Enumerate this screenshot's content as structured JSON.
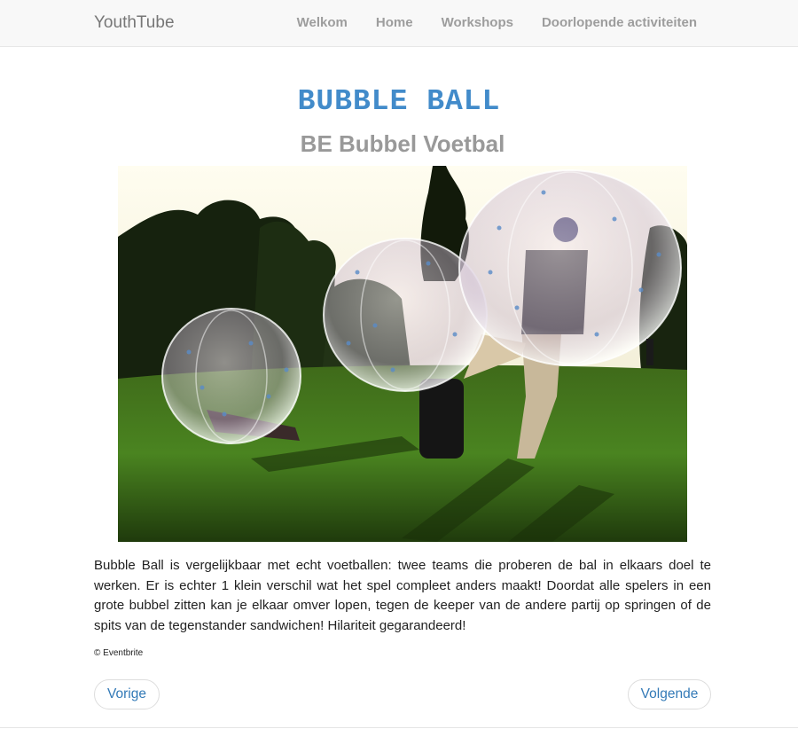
{
  "navbar": {
    "brand": "YouthTube",
    "items": [
      {
        "label": "Welkom"
      },
      {
        "label": "Home"
      },
      {
        "label": "Workshops"
      },
      {
        "label": "Doorlopende activiteiten"
      }
    ]
  },
  "main": {
    "title": "BUBBLE BALL",
    "subtitle": "BE Bubbel Voetbal",
    "description": "Bubble Ball is vergelijkbaar met echt voetballen: twee teams die proberen de bal in elkaars doel te werken. Er is echter 1 klein verschil wat het spel compleet anders maakt! Doordat alle spelers in een grote bubbel zitten kan je elkaar omver lopen, tegen de keeper van de andere partij op springen of de spits van de tegenstander sandwichen! Hilariteit gegarandeerd!",
    "credit": "© Eventbrite"
  },
  "pager": {
    "prev_label": "Vorige",
    "next_label": "Volgende"
  }
}
